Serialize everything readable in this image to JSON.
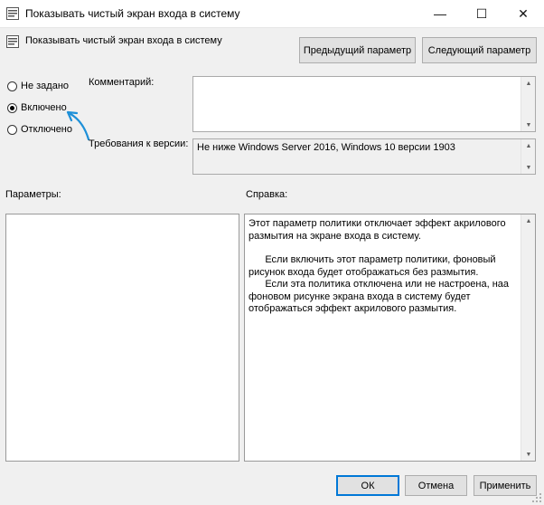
{
  "window": {
    "title": "Показывать чистый экран входа в систему",
    "minimize_glyph": "—",
    "maximize_glyph": "☐",
    "close_glyph": "✕"
  },
  "header": {
    "policy_name": "Показывать чистый экран входа в систему",
    "prev_button": "Предыдущий параметр",
    "next_button": "Следующий параметр"
  },
  "state": {
    "options": [
      {
        "label": "Не задано",
        "selected": false
      },
      {
        "label": "Включено",
        "selected": true
      },
      {
        "label": "Отключено",
        "selected": false
      }
    ]
  },
  "comment": {
    "label": "Комментарий:",
    "value": ""
  },
  "version": {
    "label": "Требования к версии:",
    "value": "Не ниже Windows Server 2016, Windows 10 версии 1903"
  },
  "params": {
    "label": "Параметры:"
  },
  "help": {
    "label": "Справка:",
    "paragraphs": [
      "Этот параметр политики отключает эффект акрилового размытия на экране входа в систему.",
      "",
      "      Если включить этот параметр политики, фоновый рисунок входа будет отображаться без размытия.",
      "      Если эта политика отключена или не настроена, наа фоновом рисунке экрана входа в систему будет отображаться эффект акрилового размытия."
    ]
  },
  "footer": {
    "ok": "ОК",
    "cancel": "Отмена",
    "apply": "Применить"
  },
  "colors": {
    "accent": "#0078d7",
    "arrow": "#1e90d8"
  },
  "icons": {
    "app": "settings-policy-icon",
    "annotation": "annotation-arrow-icon"
  }
}
